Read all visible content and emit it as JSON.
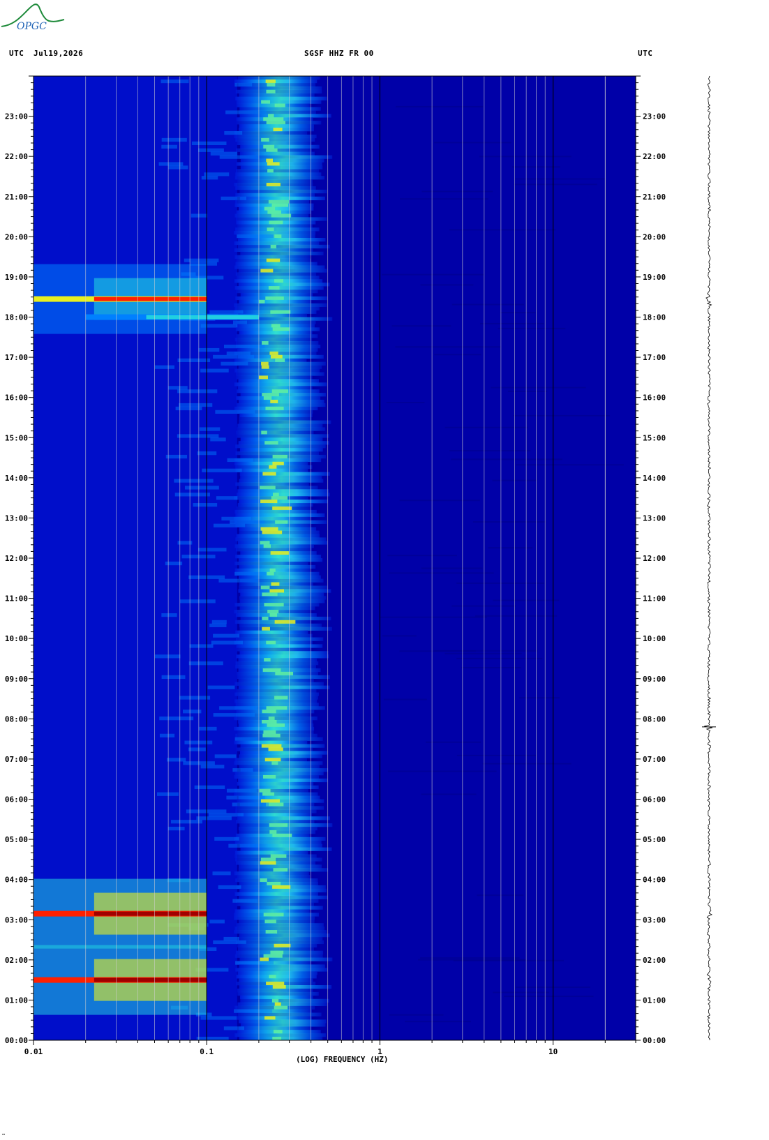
{
  "header": {
    "tz_left": "UTC",
    "date": "Jul19,2026",
    "station": "SGSF HHZ FR 00",
    "tz_right": "UTC"
  },
  "logo": {
    "text": "OPGC",
    "name": "opgc-logo"
  },
  "footer_mark": "™",
  "colors": {
    "background": "#0000a8",
    "low": "#0010d0",
    "mid": "#0080ff",
    "cyan": "#20d0e0",
    "yellow": "#e8f020",
    "red": "#ff2000",
    "darkred": "#a00000",
    "gridline": "#d0d0d0",
    "decade_line": "#000000"
  },
  "chart_data": {
    "type": "heatmap",
    "title": "SGSF HHZ FR 00",
    "xlabel": "(LOG) FREQUENCY (HZ)",
    "ylabel": "UTC",
    "x_scale": "log",
    "xlim": [
      0.01,
      30
    ],
    "x_ticks": [
      0.01,
      0.1,
      1,
      10
    ],
    "x_tick_labels": [
      "0.01",
      "0.1",
      "1",
      "10"
    ],
    "ylim_hours": [
      0,
      24
    ],
    "y_tick_labels": [
      "00:00",
      "01:00",
      "02:00",
      "03:00",
      "04:00",
      "05:00",
      "06:00",
      "07:00",
      "08:00",
      "09:00",
      "10:00",
      "11:00",
      "12:00",
      "13:00",
      "14:00",
      "15:00",
      "16:00",
      "17:00",
      "18:00",
      "19:00",
      "20:00",
      "21:00",
      "22:00",
      "23:00"
    ],
    "microseism_band_hz": [
      0.15,
      0.45
    ],
    "microseism_peak_hz": [
      0.2,
      0.3
    ],
    "events": [
      {
        "time_h": 1.5,
        "f_min_hz": 0.01,
        "f_max_hz": 0.1,
        "level": "high"
      },
      {
        "time_h": 3.15,
        "f_min_hz": 0.01,
        "f_max_hz": 0.1,
        "level": "high"
      },
      {
        "time_h": 18.45,
        "f_min_hz": 0.01,
        "f_max_hz": 0.1,
        "level": "medium"
      },
      {
        "time_h": 18.0,
        "f_min_hz": 0.02,
        "f_max_hz": 0.2,
        "level": "low"
      }
    ],
    "seismogram_spike_h": 7.8
  }
}
